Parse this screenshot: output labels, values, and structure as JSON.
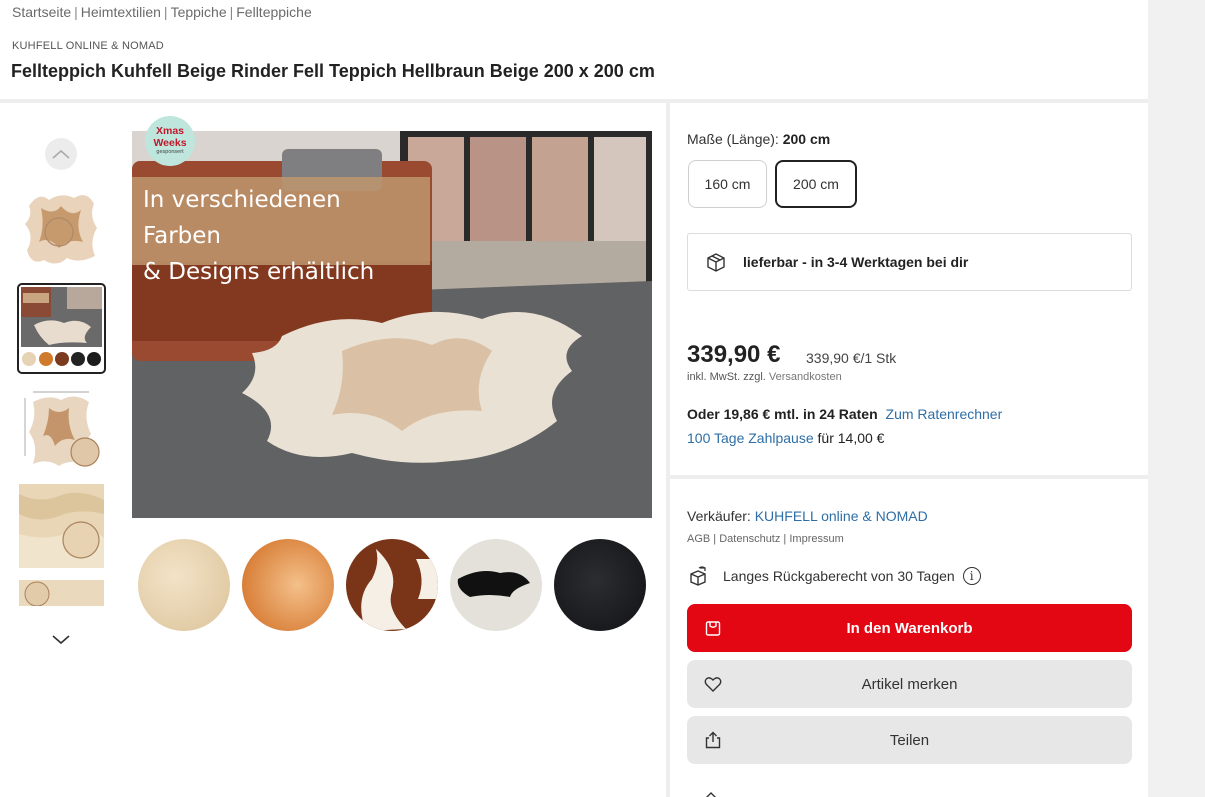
{
  "breadcrumb": [
    "Startseite",
    "Heimtextilien",
    "Teppiche",
    "Fellteppiche"
  ],
  "product": {
    "brand": "KUHFELL ONLINE & NOMAD",
    "title": "Fellteppich Kuhfell Beige Rinder Fell Teppich Hellbraun Beige 200 x 200 cm"
  },
  "gallery": {
    "promo_line1": "In verschiedenen Farben",
    "promo_line2": "& Designs erhältlich",
    "badge_line1": "Xmas",
    "badge_line2": "Weeks",
    "badge_line3": "gesponsert",
    "active_thumbnail_index": 1,
    "thumbnail_count": 5,
    "swatch_count": 5
  },
  "size": {
    "label": "Maße (Länge):",
    "selected_value": "200 cm",
    "options": [
      "160 cm",
      "200 cm"
    ]
  },
  "delivery": {
    "text": "lieferbar - in 3-4 Werktagen bei dir"
  },
  "pricing": {
    "price": "339,90 €",
    "unit_price": "339,90 €/1 Stk",
    "tax_prefix": "inkl. MwSt. zzgl.",
    "tax_link": "Versandkosten",
    "installment_text": "Oder 19,86 € mtl. in 24 Raten",
    "installment_link": "Zum Ratenrechner",
    "pause_link": "100 Tage Zahlpause",
    "pause_suffix": "für 14,00 €"
  },
  "seller": {
    "label": "Verkäufer:",
    "name": "KUHFELL online & NOMAD",
    "agb": "AGB",
    "privacy": "Datenschutz",
    "imprint": "Impressum",
    "return_text": "Langes Rückgaberecht von 30 Tagen",
    "info_glyph": "i"
  },
  "actions": {
    "cart": "In den Warenkorb",
    "watch": "Artikel merken",
    "share": "Teilen"
  },
  "colors": {
    "cart_red": "#e30613",
    "link_blue": "#2e6ea6",
    "button_gray": "#e7e7e7"
  },
  "icons": {
    "scroll_up": "chevron-up-icon",
    "scroll_down": "chevron-down-icon",
    "delivery": "package-icon",
    "return": "return-box-icon",
    "info": "info-icon",
    "cart": "cart-icon",
    "watch": "heart-icon",
    "share": "share-icon"
  }
}
